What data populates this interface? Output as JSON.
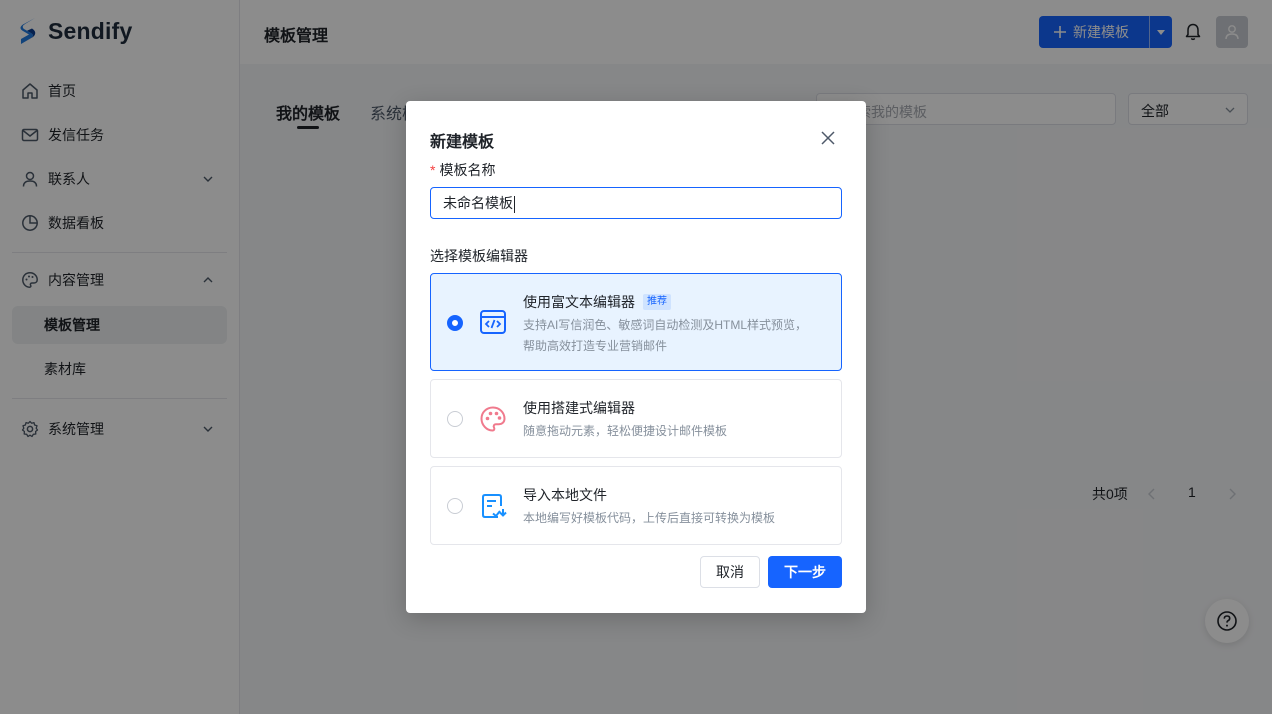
{
  "app": {
    "name": "Sendify"
  },
  "sidebar": {
    "items": [
      {
        "label": "首页",
        "icon": "home-icon"
      },
      {
        "label": "发信任务",
        "icon": "mail-icon"
      },
      {
        "label": "联系人",
        "icon": "user-icon"
      },
      {
        "label": "数据看板",
        "icon": "pie-chart-icon"
      },
      {
        "label": "内容管理",
        "icon": "palette-icon"
      },
      {
        "label": "模板管理"
      },
      {
        "label": "素材库"
      },
      {
        "label": "系统管理",
        "icon": "gear-icon"
      }
    ]
  },
  "header": {
    "title": "模板管理",
    "new_button": "新建模板"
  },
  "main": {
    "tabs": [
      "我的模板",
      "系统模"
    ],
    "search_placeholder": "索我的模板",
    "filter_value": "全部",
    "pager": {
      "total": "共0项",
      "page": "1"
    }
  },
  "modal": {
    "title": "新建模板",
    "required_mark": "*",
    "name_label": "模板名称",
    "name_value": "未命名模板",
    "editor_label": "选择模板编辑器",
    "options": [
      {
        "title": "使用富文本编辑器",
        "badge": "推荐",
        "desc_line1": "支持AI写信润色、敏感词自动检测及HTML样式预览，",
        "desc_line2": "帮助高效打造专业营销邮件",
        "icon": "code-window-icon",
        "selected": true
      },
      {
        "title": "使用搭建式编辑器",
        "desc_line1": "随意拖动元素，轻松便捷设计邮件模板",
        "icon": "palette-icon",
        "selected": false
      },
      {
        "title": "导入本地文件",
        "desc_line1": "本地编写好模板代码，上传后直接可转换为模板",
        "icon": "file-import-icon",
        "selected": false
      }
    ],
    "cancel_label": "取消",
    "next_label": "下一步"
  },
  "colors": {
    "primary": "#1664ff",
    "selected_bg": "#e8f3ff",
    "required": "#f53f3f"
  }
}
